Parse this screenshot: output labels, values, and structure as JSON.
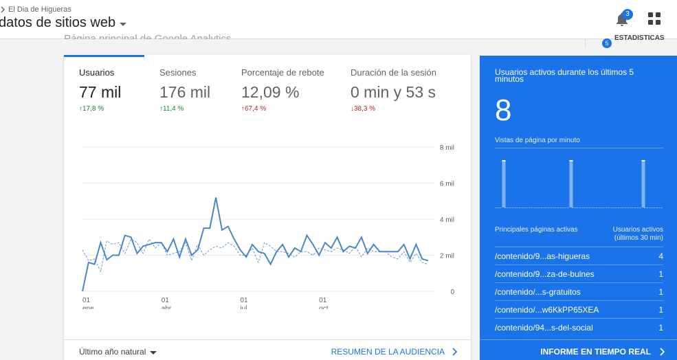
{
  "header": {
    "breadcrumb": "El Dia de Higueras",
    "property": "datos de sitios web",
    "subtitle": "Página principal de Google Analytics",
    "notifications_count": "3",
    "stats_count": "5",
    "stats_label": "ESTADÍSTICAS"
  },
  "metrics": [
    {
      "label": "Usuarios",
      "value": "77 mil",
      "change": "17,8 %",
      "direction": "up"
    },
    {
      "label": "Sesiones",
      "value": "176 mil",
      "change": "11,4 %",
      "direction": "up"
    },
    {
      "label": "Porcentaje de rebote",
      "value": "12,09 %",
      "change": "67,4 %",
      "direction": "up-bad"
    },
    {
      "label": "Duración de la sesión",
      "value": "0 min y 53 s",
      "change": "38,3 %",
      "direction": "down"
    }
  ],
  "chart_data": {
    "type": "line",
    "y_ticks": [
      "8 mil",
      "6 mil",
      "4 mil",
      "2 mil",
      "0"
    ],
    "ylim": [
      0,
      8000
    ],
    "x_ticks": [
      {
        "day": "01",
        "month": "ene",
        "index": 0
      },
      {
        "day": "01",
        "month": "abr",
        "index": 13
      },
      {
        "day": "01",
        "month": "jul",
        "index": 26
      },
      {
        "day": "01",
        "month": "oct",
        "index": 39
      }
    ],
    "series": [
      {
        "style": "solid",
        "values": [
          0,
          1600,
          1500,
          2700,
          1750,
          2000,
          2000,
          3100,
          3000,
          2100,
          2500,
          2600,
          2700,
          2700,
          2200,
          2900,
          1900,
          2900,
          2000,
          2300,
          3500,
          3500,
          5200,
          3400,
          3600,
          2900,
          2300,
          1900,
          2600,
          2200,
          2100,
          1500,
          2200,
          2600,
          1900,
          2400,
          2200,
          3100,
          2600,
          2000,
          2700,
          2400,
          3000,
          2200,
          2500,
          2400,
          3000,
          2100,
          2600,
          2200,
          2200,
          2200,
          2200,
          2600,
          1800,
          2600,
          1800,
          1700
        ]
      },
      {
        "style": "dashed",
        "values": [
          2300,
          1700,
          1800,
          1100,
          2800,
          2600,
          2700,
          2100,
          2900,
          2700,
          2100,
          2900,
          2400,
          2700,
          2000,
          2100,
          2200,
          2700,
          1700,
          2600,
          2000,
          2300,
          2500,
          2400,
          2700,
          2500,
          2000,
          2000,
          2400,
          1600,
          2700,
          2500,
          2200,
          2200,
          2100,
          1900,
          2200,
          2200,
          2000,
          2400,
          2300,
          2200,
          2400,
          2300,
          2100,
          2500,
          1900,
          2400,
          2200,
          2200,
          2200,
          1900,
          1800,
          2200,
          1600,
          2100,
          1600,
          1500
        ]
      }
    ]
  },
  "footer": {
    "date_range": "Último año natural",
    "audience_link": "RESUMEN DE LA AUDIENCIA"
  },
  "realtime": {
    "title": "Usuarios activos durante los últimos 5 minutos",
    "active_users": "8",
    "pageviews_label": "Vistas de página por minuto",
    "pageviews_per_minute": [
      0,
      0,
      0,
      1,
      0,
      0,
      0,
      0,
      0,
      0,
      0,
      0,
      0,
      0,
      0,
      0,
      0,
      0,
      0,
      0,
      0,
      0,
      0,
      0,
      0,
      0,
      0,
      0,
      0,
      0,
      0,
      1,
      0,
      0,
      0,
      0,
      0,
      0,
      0,
      0,
      0,
      0,
      0,
      0,
      0,
      0,
      0,
      0,
      0,
      0,
      0,
      0,
      0,
      0,
      0,
      0,
      0,
      0,
      0,
      0,
      0,
      1,
      0,
      0,
      0,
      0,
      0,
      0,
      0,
      0
    ],
    "table_header_left": "Principales páginas activas",
    "table_header_right_1": "Usuarios activos",
    "table_header_right_2": "(últimos 30 min)",
    "pages": [
      {
        "path": "/contenido/9...as-higueras",
        "users": "4"
      },
      {
        "path": "/contenido/9...za-de-bulnes",
        "users": "1"
      },
      {
        "path": "/contenido/...s-gratuitos",
        "users": "1"
      },
      {
        "path": "/contenido/...w6KkPP65XEA",
        "users": "1"
      },
      {
        "path": "/contenido/94...s-del-social",
        "users": "1"
      }
    ],
    "link": "INFORME EN TIEMPO REAL"
  },
  "colors": {
    "accent": "#1a73e8",
    "series_line": "#4a86c8",
    "up": "#188038",
    "down": "#c5221f"
  }
}
